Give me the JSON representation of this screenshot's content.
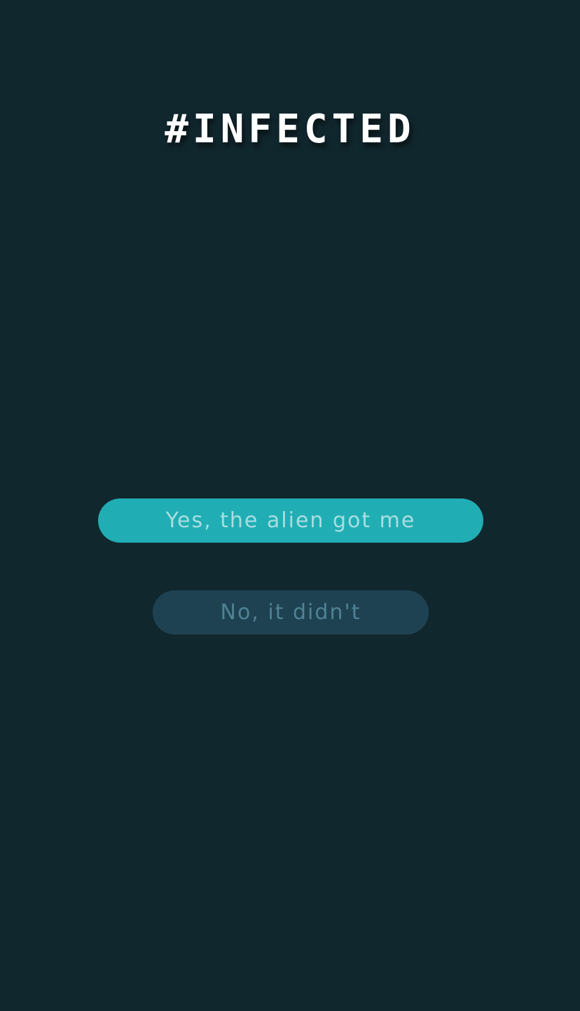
{
  "title": "#INFECTED",
  "actions": {
    "yes_label": "Yes, the alien got me",
    "no_label": "No, it didn't"
  },
  "colors": {
    "background": "#11272e",
    "primary_button": "#20aeb4",
    "primary_button_text": "#a9dde0",
    "secondary_button": "#1e4252",
    "secondary_button_text": "#4f8294",
    "title_text": "#ffffff"
  }
}
